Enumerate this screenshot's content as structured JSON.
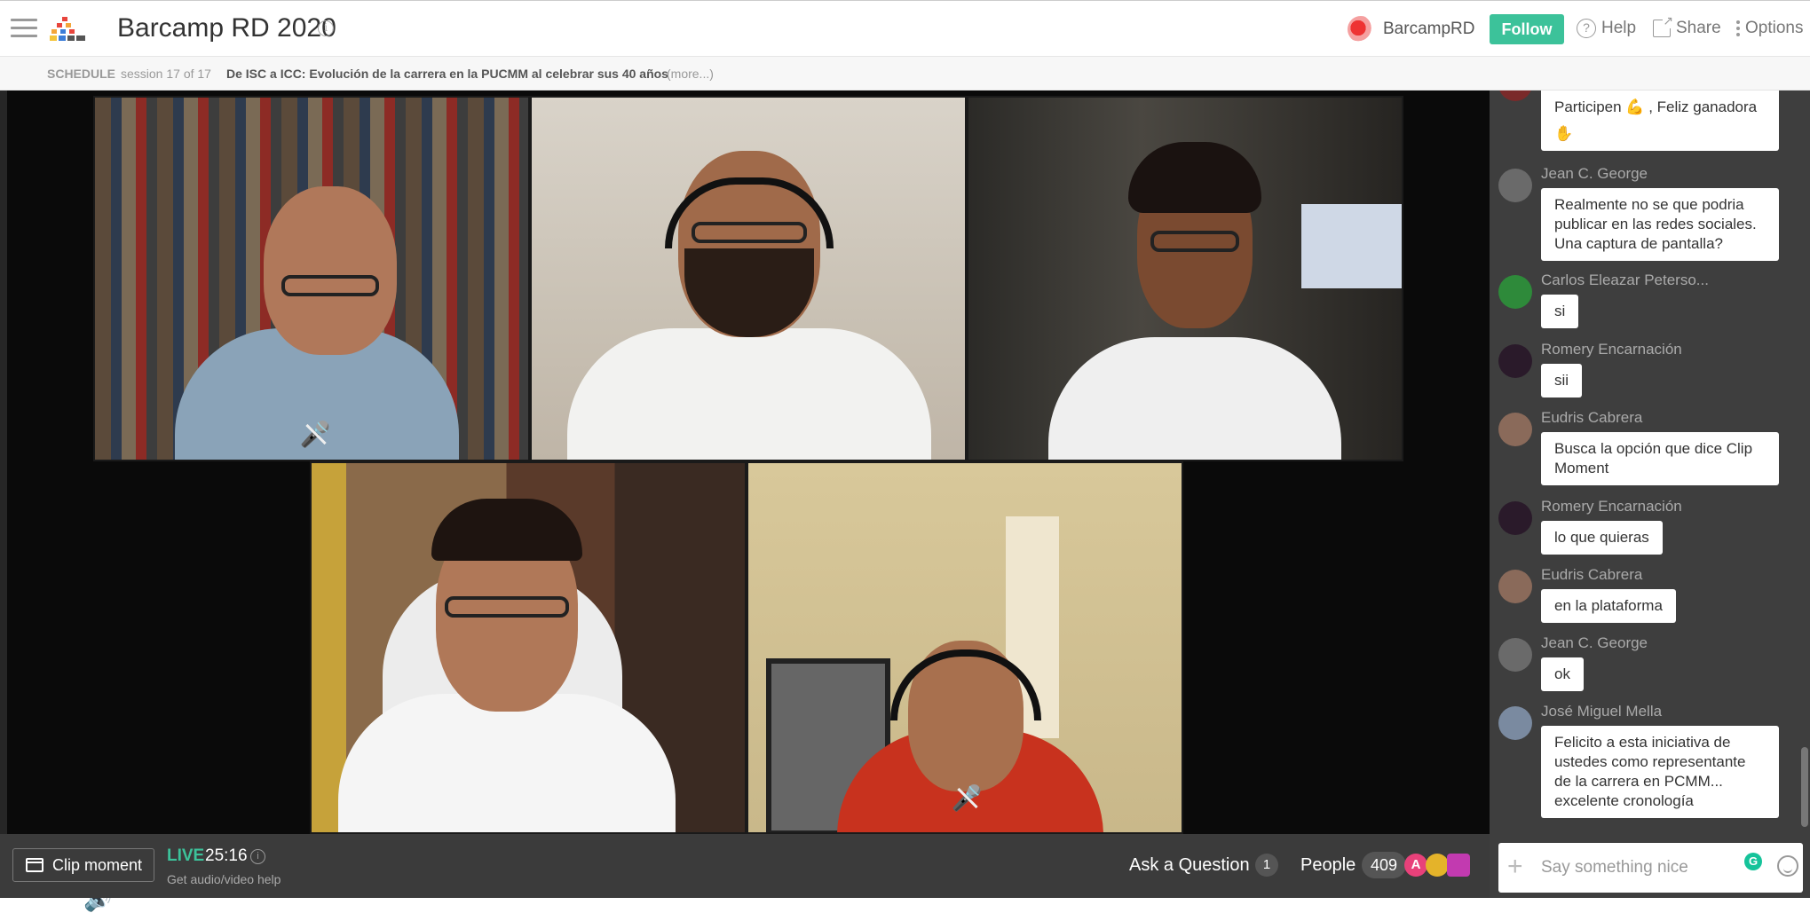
{
  "header": {
    "event_title": "Barcamp RD 2020",
    "info_icon": "info-icon",
    "organizer": "BarcampRD",
    "follow_label": "Follow",
    "help_label": "Help",
    "share_label": "Share",
    "options_label": "Options"
  },
  "schedule": {
    "label": "SCHEDULE",
    "session": "session 17 of 17",
    "title": "De ISC a ICC: Evolución de la carrera en la PUCMM al celebrar sus 40 años",
    "more": "(more...)"
  },
  "bottom": {
    "clip_label": "Clip moment",
    "live_label": "LIVE",
    "time": "25:16",
    "av_help": "Get audio/video help",
    "ask_label": "Ask a Question",
    "ask_count": "1",
    "people_label": "People",
    "people_count": "409",
    "people_avatar_letter": "A"
  },
  "chat": {
    "messages": [
      {
        "name": "",
        "text": "Participen 💪 , Feliz ganadora ✋"
      },
      {
        "name": "Jean C. George",
        "text": "Realmente no se que podria publicar en las redes sociales. Una captura de pantalla?"
      },
      {
        "name": "Carlos Eleazar Peterso...",
        "text": "si"
      },
      {
        "name": "Romery Encarnación",
        "text": "sii"
      },
      {
        "name": "Eudris Cabrera",
        "text": "Busca la opción que dice Clip Moment"
      },
      {
        "name": "Romery Encarnación",
        "text": "lo que quieras"
      },
      {
        "name": "Eudris Cabrera",
        "text": "en la plataforma"
      },
      {
        "name": "Jean C. George",
        "text": "ok"
      },
      {
        "name": "José Miguel Mella",
        "text": "Felicito a esta iniciativa de ustedes como representante de la carrera en PCMM... excelente cronología"
      }
    ],
    "input_placeholder": "Say something nice",
    "grammarly": "G"
  },
  "colors": {
    "accent": "#3cc29a",
    "chat_bg": "#3e3e3e",
    "bottom_bg": "#3b3b3b"
  }
}
